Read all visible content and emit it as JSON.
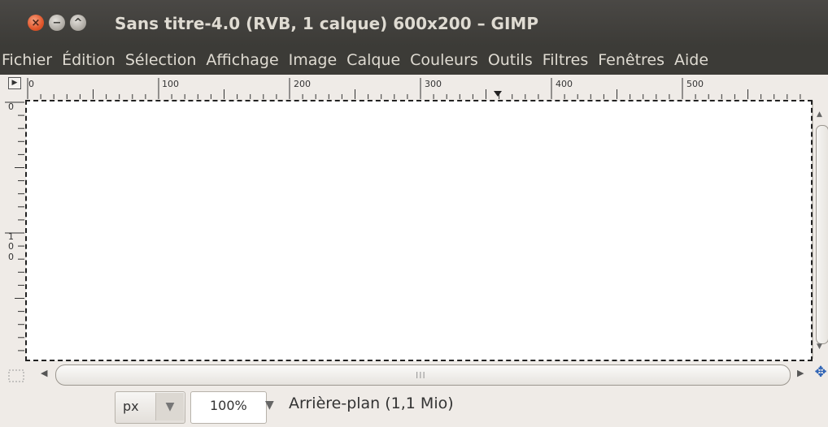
{
  "window": {
    "title": "Sans titre-4.0 (RVB, 1 calque) 600x200 – GIMP",
    "close_glyph": "×",
    "minimize_glyph": "−",
    "maximize_glyph": "^"
  },
  "menubar": {
    "items": [
      "Fichier",
      "Édition",
      "Sélection",
      "Affichage",
      "Image",
      "Calque",
      "Couleurs",
      "Outils",
      "Filtres",
      "Fenêtres",
      "Aide"
    ]
  },
  "rulers": {
    "horizontal_labels": [
      "0",
      "100",
      "200",
      "300",
      "400",
      "500"
    ],
    "vertical_labels": [
      "0",
      "1",
      "0",
      "0"
    ]
  },
  "scrollbar": {
    "left_arrow": "◀",
    "right_arrow": "▶",
    "grip": "III"
  },
  "statusbar": {
    "unit": "px",
    "zoom": "100%",
    "layer_info": "Arrière-plan (1,1 Mio)",
    "dropdown_glyph": "▼"
  },
  "colors": {
    "titlebar": "#3c3b37",
    "close_button": "#e2562b",
    "canvas": "#ffffff",
    "background": "#efebe7"
  },
  "icons": {
    "close": "close-icon",
    "minimize": "minimize-icon",
    "maximize": "maximize-icon",
    "quick_mask": "quick-mask-icon",
    "navigate": "navigate-icon",
    "menu_arrow": "menu-arrow-icon"
  }
}
